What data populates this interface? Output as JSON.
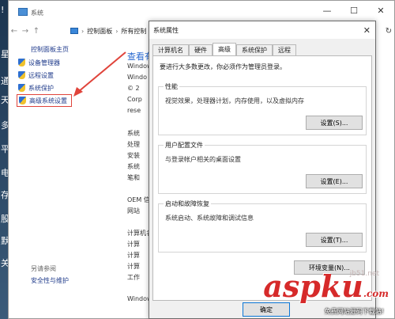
{
  "desktop": {
    "items": [
      "!",
      "星",
      "通",
      "天",
      "多",
      "平",
      "电",
      "存",
      "股",
      "默",
      "关"
    ]
  },
  "window": {
    "title": "系统",
    "controls": [
      "—",
      "☐",
      "✕"
    ]
  },
  "address": {
    "crumbs": [
      "控制面板",
      "所有控制"
    ],
    "refresh_icon": "↻"
  },
  "left_nav": {
    "home": "控制面板主页",
    "links": [
      "设备管理器",
      "远程设置",
      "系统保护",
      "高级系统设置"
    ],
    "see_also": "另请参阅",
    "security": "安全性与维护"
  },
  "main": {
    "heading": "查看有",
    "lines": [
      "Windows",
      "Windo",
      "© 2",
      "Corp",
      "rese",
      "",
      "系统",
      "处理",
      "安装",
      "系统",
      "笔和",
      "",
      "OEM 信息",
      "网站",
      "",
      "计算机名",
      "计算",
      "计算",
      "计算",
      "工作",
      "",
      "Windows"
    ]
  },
  "dialog": {
    "title": "系统属性",
    "tabs": [
      "计算机名",
      "硬件",
      "高级",
      "系统保护",
      "远程"
    ],
    "active_tab": "高级",
    "admin_note": "要进行大多数更改，你必须作为管理员登录。",
    "performance": {
      "label": "性能",
      "desc": "视觉效果，处理器计划，内存使用，以及虚拟内存",
      "button": "设置(S)..."
    },
    "profiles": {
      "label": "用户配置文件",
      "desc": "与登录帐户相关的桌面设置",
      "button": "设置(E)..."
    },
    "startup": {
      "label": "启动和故障恢复",
      "desc": "系统启动、系统故障和调试信息",
      "button": "设置(T)..."
    },
    "env_button": "环境变量(N)...",
    "ok_button": "确定"
  },
  "watermark": {
    "text": "aspku",
    "suffix": ".com",
    "sub": "免费网站源码下载站!",
    "small": "jb51.net"
  },
  "colors": {
    "link": "#1e3a8a",
    "highlight": "#e0443b",
    "watermark": "#d62a2a"
  }
}
